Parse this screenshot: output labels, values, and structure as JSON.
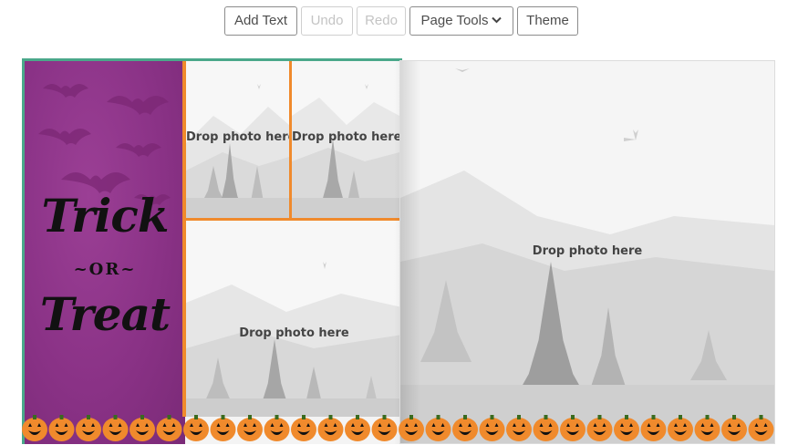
{
  "toolbar": {
    "add_text": "Add Text",
    "undo": "Undo",
    "redo": "Redo",
    "page_tools": "Page Tools",
    "theme": "Theme"
  },
  "left_page": {
    "title_line1": "Trick",
    "title_line2": "~OR~",
    "title_line3": "Treat",
    "slots": [
      {
        "label": "Drop photo here"
      },
      {
        "label": "Drop photo here"
      },
      {
        "label": "Drop photo here"
      }
    ]
  },
  "right_page": {
    "slot": {
      "label": "Drop photo here"
    }
  },
  "colors": {
    "accent_border": "#4aa88a",
    "purple_panel": "#8a3286",
    "photo_divider": "#f08a2c",
    "pumpkin": "#f08a2c"
  },
  "icons": [
    "chevron-down-icon",
    "bat-icon",
    "pine-tree-icon",
    "pumpkin-icon"
  ]
}
